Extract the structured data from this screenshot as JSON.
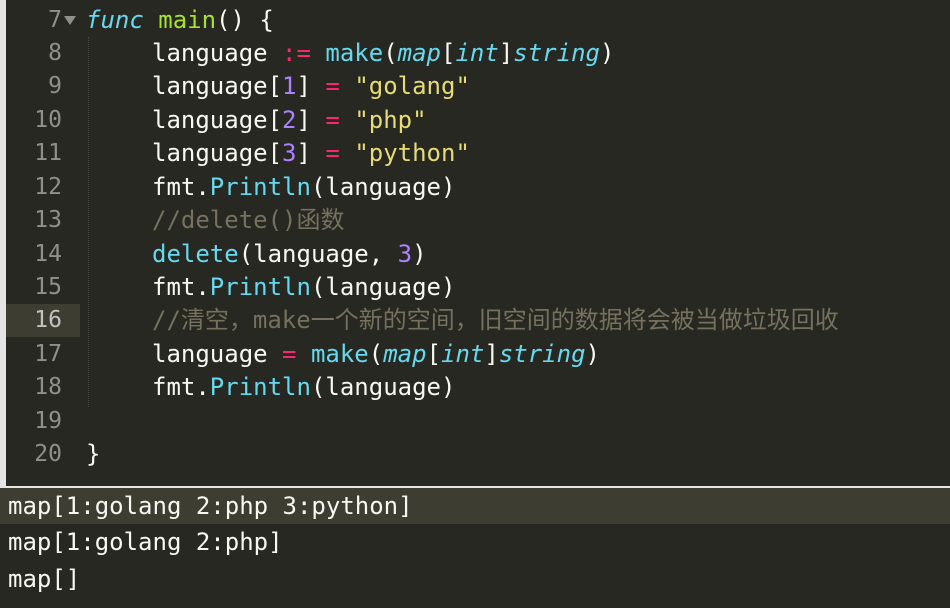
{
  "editor": {
    "line_numbers": [
      "7",
      "8",
      "9",
      "10",
      "11",
      "12",
      "13",
      "14",
      "15",
      "16",
      "17",
      "18",
      "19",
      "20"
    ],
    "active_line": "16",
    "lines": {
      "l7": {
        "kw": "func",
        "name": "main",
        "rest": "() {"
      },
      "l8": {
        "var": "language ",
        "op": ":=",
        "sp": " ",
        "fn": "make",
        "p1": "(",
        "type1": "map",
        "b1": "[",
        "type2": "int",
        "b2": "]",
        "type3": "string",
        "p2": ")"
      },
      "l9": {
        "var": "language[",
        "num": "1",
        "rb": "] ",
        "op": "=",
        "sp": " ",
        "str": "\"golang\""
      },
      "l10": {
        "var": "language[",
        "num": "2",
        "rb": "] ",
        "op": "=",
        "sp": " ",
        "str": "\"php\""
      },
      "l11": {
        "var": "language[",
        "num": "3",
        "rb": "] ",
        "op": "=",
        "sp": " ",
        "str": "\"python\""
      },
      "l12": {
        "pkg": "fmt.",
        "call": "Println",
        "args": "(language)"
      },
      "l13": {
        "cmt": "//delete()函数"
      },
      "l14": {
        "call": "delete",
        "args1": "(language, ",
        "num": "3",
        "args2": ")"
      },
      "l15": {
        "pkg": "fmt.",
        "call": "Println",
        "args": "(language)"
      },
      "l16": {
        "cmt": "//清空，make一个新的空间，旧空间的数据将会被当做垃圾回收"
      },
      "l17": {
        "var": "language ",
        "op": "=",
        "sp": " ",
        "fn": "make",
        "p1": "(",
        "type1": "map",
        "b1": "[",
        "type2": "int",
        "b2": "]",
        "type3": "string",
        "p2": ")"
      },
      "l18": {
        "pkg": "fmt.",
        "call": "Println",
        "args": "(language)"
      },
      "l20": {
        "brace": "}"
      }
    },
    "colors": {
      "bg": "#272822",
      "keyword": "#66d9ef",
      "function": "#a6e22e",
      "operator": "#f92672",
      "number": "#ae81ff",
      "string": "#e6db74",
      "comment": "#75715e"
    }
  },
  "console": {
    "lines": [
      "map[1:golang 2:php 3:python]",
      "map[1:golang 2:php]",
      "map[]"
    ]
  }
}
